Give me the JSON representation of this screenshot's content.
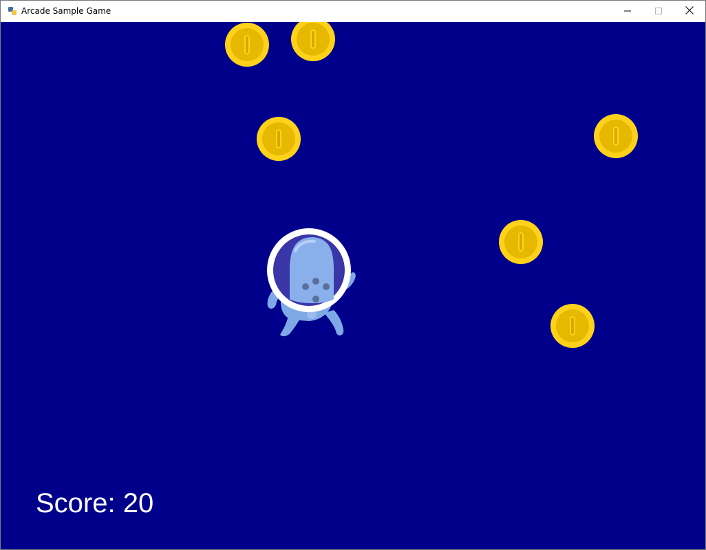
{
  "window": {
    "title": "Arcade Sample Game",
    "icons": {
      "app": "python-app-icon",
      "minimize": "minimize-icon",
      "maximize": "maximize-icon",
      "close": "close-icon"
    }
  },
  "game": {
    "background_color": "#00008b",
    "score_label": "Score: 20",
    "player": {
      "sprite": "alien-astronaut-icon"
    },
    "coins": [
      {
        "sprite": "gold-coin-icon"
      },
      {
        "sprite": "gold-coin-icon"
      },
      {
        "sprite": "gold-coin-icon"
      },
      {
        "sprite": "gold-coin-icon"
      },
      {
        "sprite": "gold-coin-icon"
      },
      {
        "sprite": "gold-coin-icon"
      }
    ]
  }
}
